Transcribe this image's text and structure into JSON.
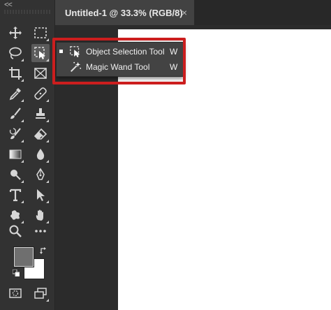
{
  "toolbar": {
    "collapse_glyph": "<<",
    "tools": [
      {
        "icon": "move-icon"
      },
      {
        "icon": "rectangular-marquee-icon"
      },
      {
        "icon": "lasso-icon"
      },
      {
        "icon": "object-selection-icon",
        "active": true
      },
      {
        "icon": "crop-icon"
      },
      {
        "icon": "frame-icon"
      },
      {
        "icon": "eyedropper-icon"
      },
      {
        "icon": "healing-brush-icon"
      },
      {
        "icon": "brush-icon"
      },
      {
        "icon": "clone-stamp-icon"
      },
      {
        "icon": "history-brush-icon"
      },
      {
        "icon": "eraser-icon"
      },
      {
        "icon": "gradient-icon"
      },
      {
        "icon": "blur-icon"
      },
      {
        "icon": "dodge-icon"
      },
      {
        "icon": "pen-icon"
      },
      {
        "icon": "type-icon"
      },
      {
        "icon": "path-selection-icon"
      },
      {
        "icon": "custom-shape-icon"
      },
      {
        "icon": "hand-icon"
      },
      {
        "icon": "zoom-icon"
      },
      {
        "icon": "more-tools-icon"
      }
    ],
    "foreground_color": "#6f6f6f",
    "background_color": "#ffffff"
  },
  "document": {
    "tab_title": "Untitled-1 @ 33.3% (RGB/8)",
    "close_glyph": "×"
  },
  "flyout": {
    "items": [
      {
        "label": "Object Selection Tool",
        "shortcut": "W",
        "selected": true,
        "icon": "object-selection-icon"
      },
      {
        "label": "Magic Wand Tool",
        "shortcut": "W",
        "selected": false,
        "icon": "magic-wand-icon"
      }
    ]
  },
  "colors": {
    "toolbar_bg": "#323232",
    "canvas": "#ffffff",
    "highlight": "#cc1e1e"
  }
}
